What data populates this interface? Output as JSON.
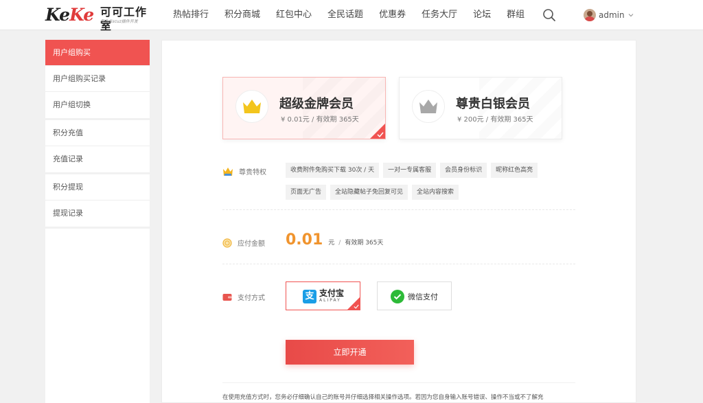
{
  "header": {
    "logo_mark": "KeKe",
    "logo_name": "可可工作室",
    "logo_slogan": "专业discuz插件开发",
    "nav": [
      "热帖排行",
      "积分商城",
      "红包中心",
      "全民话题",
      "优惠券",
      "任务大厅",
      "论坛",
      "群组"
    ],
    "user": "admin"
  },
  "sidebar": {
    "groups": [
      [
        "用户组购买",
        "用户组购买记录",
        "用户组切换"
      ],
      [
        "积分充值",
        "充值记录"
      ],
      [
        "积分提现",
        "提现记录"
      ]
    ]
  },
  "plans": [
    {
      "title": "超级金牌会员",
      "price": "¥ 0.01元 / 有效期 365天",
      "icon": "gold-crown-icon",
      "selected": true
    },
    {
      "title": "尊贵白银会员",
      "price": "¥ 200元 / 有效期 365天",
      "icon": "silver-crown-icon",
      "selected": false
    }
  ],
  "perks": {
    "label": "尊贵特权",
    "items": [
      "收费附件免购买下载 30次 / 天",
      "一对一专属客服",
      "会员身份标识",
      "昵称红色高亮",
      "页面无广告",
      "全站隐藏帖子免回复可见",
      "全站内容搜索"
    ]
  },
  "payment_amount": {
    "label": "应付金额",
    "amount": "0.01",
    "unit": "元",
    "separator": "/",
    "validity": "有效期 365天"
  },
  "payment_method": {
    "label": "支付方式",
    "alipay_cn": "支付宝",
    "alipay_en": "ALIPAY",
    "alipay_glyph": "支",
    "wechat": "微信支付"
  },
  "submit_label": "立即开通",
  "notice": "在使用充值方式时，您务必仔细确认自己的账号并仔细选择相关操作选项。若因为您自身输入账号错误、操作不当或不了解充",
  "colors": {
    "accent": "#f05351",
    "price": "#f0942e",
    "alipay": "#1a9ee6",
    "wechat": "#2dba38",
    "gold": "#f3c51d",
    "silver": "#a8a8a8"
  }
}
